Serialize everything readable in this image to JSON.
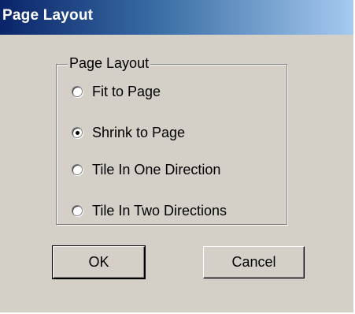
{
  "window": {
    "title": "Page Layout"
  },
  "group": {
    "label": "Page Layout",
    "options": [
      {
        "label": "Fit to Page",
        "selected": false
      },
      {
        "label": "Shrink to Page",
        "selected": true
      },
      {
        "label": "Tile In One Direction",
        "selected": false
      },
      {
        "label": "Tile In Two Directions",
        "selected": false
      }
    ]
  },
  "buttons": {
    "ok_label": "OK",
    "cancel_label": "Cancel"
  },
  "colors": {
    "title_bar_start": "#0a246a",
    "title_bar_end": "#a6caf0",
    "dialog_background": "#d4d0c8"
  }
}
